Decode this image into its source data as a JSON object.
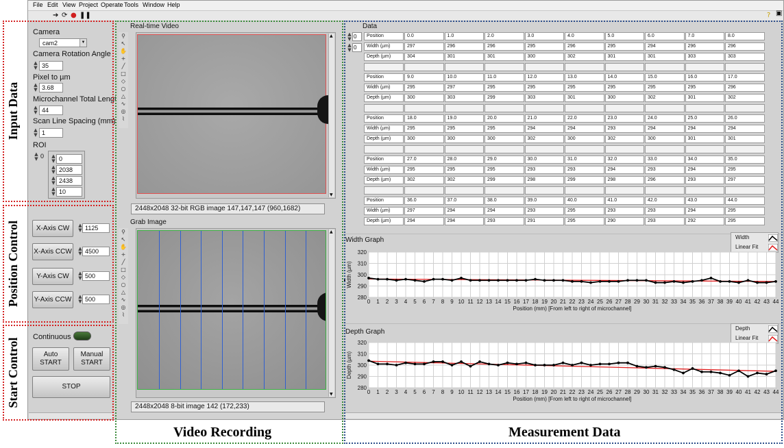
{
  "menu": [
    "File",
    "Edit",
    "View",
    "Project",
    "Operate",
    "Tools",
    "Window",
    "Help"
  ],
  "toolbar_icons": [
    "run-arrow-icon",
    "run-continuous-icon",
    "abort-icon",
    "pause-icon"
  ],
  "input_data": {
    "section_label": "Input Data",
    "camera_label": "Camera",
    "camera_value": "cam2",
    "rotation_label": "Camera Rotation Angle",
    "rotation_value": "35",
    "pixel_label": "Pixel to µm",
    "pixel_value": "3.68",
    "length_label": "Microchannel Total Length",
    "length_value": "44",
    "spacing_label": "Scan Line Spacing (mm)",
    "spacing_value": "1",
    "roi_label": "ROI",
    "roi_index": "0",
    "roi_values": [
      "0",
      "2038",
      "2438",
      "10"
    ]
  },
  "position_control": {
    "section_label": "Position Control",
    "buttons": [
      {
        "label": "X-Axis CW",
        "value": "1125"
      },
      {
        "label": "X-Axis CCW",
        "value": "4500"
      },
      {
        "label": "Y-Axis CW",
        "value": "500"
      },
      {
        "label": "Y-Axis CCW",
        "value": "500"
      }
    ]
  },
  "start_control": {
    "section_label": "Start Control",
    "continuous_label": "Continuous",
    "auto_label": "Auto START",
    "manual_label": "Manual START",
    "stop_label": "STOP"
  },
  "video": {
    "section_label": "Video Recording",
    "realtime_title": "Real-time Video",
    "realtime_status": "2448x2048 32-bit RGB image 147,147,147    (960,1682)",
    "grab_title": "Grab Image",
    "grab_status": "2448x2048 8-bit image 142    (172,233)",
    "colors": {
      "realtime_border": "#e05050",
      "grab_border": "#3cb043",
      "scan_lines": "#2f5fd0"
    }
  },
  "measurement": {
    "section_label": "Measurement Data",
    "data_title": "Data",
    "index_a": "0",
    "index_b": "0",
    "row_labels": [
      "Position",
      "Width (µm)",
      "Depth (µm)"
    ],
    "blocks": [
      {
        "position": [
          "0.0",
          "1.0",
          "2.0",
          "3.0",
          "4.0",
          "5.0",
          "6.0",
          "7.0",
          "8.0"
        ],
        "width": [
          "297",
          "296",
          "296",
          "295",
          "296",
          "295",
          "294",
          "296",
          "296"
        ],
        "depth": [
          "304",
          "301",
          "301",
          "300",
          "302",
          "301",
          "301",
          "303",
          "303"
        ]
      },
      {
        "position": [
          "9.0",
          "10.0",
          "11.0",
          "12.0",
          "13.0",
          "14.0",
          "15.0",
          "16.0",
          "17.0"
        ],
        "width": [
          "295",
          "297",
          "295",
          "295",
          "295",
          "295",
          "295",
          "295",
          "296"
        ],
        "depth": [
          "300",
          "303",
          "299",
          "303",
          "301",
          "300",
          "302",
          "301",
          "302"
        ]
      },
      {
        "position": [
          "18.0",
          "19.0",
          "20.0",
          "21.0",
          "22.0",
          "23.0",
          "24.0",
          "25.0",
          "26.0"
        ],
        "width": [
          "295",
          "295",
          "295",
          "294",
          "294",
          "293",
          "294",
          "294",
          "294"
        ],
        "depth": [
          "300",
          "300",
          "300",
          "302",
          "300",
          "302",
          "300",
          "301",
          "301"
        ]
      },
      {
        "position": [
          "27.0",
          "28.0",
          "29.0",
          "30.0",
          "31.0",
          "32.0",
          "33.0",
          "34.0",
          "35.0"
        ],
        "width": [
          "295",
          "295",
          "295",
          "293",
          "293",
          "294",
          "293",
          "294",
          "295"
        ],
        "depth": [
          "302",
          "302",
          "299",
          "298",
          "299",
          "298",
          "296",
          "293",
          "297"
        ]
      },
      {
        "position": [
          "36.0",
          "37.0",
          "38.0",
          "39.0",
          "40.0",
          "41.0",
          "42.0",
          "43.0",
          "44.0"
        ],
        "width": [
          "297",
          "294",
          "294",
          "293",
          "295",
          "293",
          "293",
          "294",
          "295"
        ],
        "depth": [
          "294",
          "294",
          "293",
          "291",
          "295",
          "290",
          "293",
          "292",
          "295"
        ]
      }
    ]
  },
  "chart_data": [
    {
      "type": "line",
      "title": "Width Graph",
      "xlabel": "Position (mm) [From left to right of microchannel]",
      "ylabel": "Width (µm)",
      "ylim": [
        280,
        320
      ],
      "yticks": [
        280,
        290,
        300,
        310,
        320
      ],
      "xlim": [
        0,
        44
      ],
      "x": [
        0,
        1,
        2,
        3,
        4,
        5,
        6,
        7,
        8,
        9,
        10,
        11,
        12,
        13,
        14,
        15,
        16,
        17,
        18,
        19,
        20,
        21,
        22,
        23,
        24,
        25,
        26,
        27,
        28,
        29,
        30,
        31,
        32,
        33,
        34,
        35,
        36,
        37,
        38,
        39,
        40,
        41,
        42,
        43,
        44
      ],
      "series": [
        {
          "name": "Width",
          "values": [
            297,
            296,
            296,
            295,
            296,
            295,
            294,
            296,
            296,
            295,
            297,
            295,
            295,
            295,
            295,
            295,
            295,
            295,
            296,
            295,
            295,
            295,
            294,
            294,
            293,
            294,
            294,
            294,
            295,
            295,
            295,
            293,
            293,
            294,
            293,
            294,
            295,
            297,
            294,
            294,
            293,
            295,
            293,
            293,
            294,
            295
          ]
        },
        {
          "name": "Linear Fit",
          "values": [
            296.2,
            294.0
          ]
        }
      ],
      "legend": "top-right",
      "grid": true,
      "colors": {
        "data": "#000000",
        "fit": "#e02020"
      }
    },
    {
      "type": "line",
      "title": "Depth Graph",
      "xlabel": "Position (mm) [From left to right of microchannel]",
      "ylabel": "Depth (µm)",
      "ylim": [
        280,
        320
      ],
      "yticks": [
        280,
        290,
        300,
        310,
        320
      ],
      "xlim": [
        0,
        44
      ],
      "x": [
        0,
        1,
        2,
        3,
        4,
        5,
        6,
        7,
        8,
        9,
        10,
        11,
        12,
        13,
        14,
        15,
        16,
        17,
        18,
        19,
        20,
        21,
        22,
        23,
        24,
        25,
        26,
        27,
        28,
        29,
        30,
        31,
        32,
        33,
        34,
        35,
        36,
        37,
        38,
        39,
        40,
        41,
        42,
        43,
        44
      ],
      "series": [
        {
          "name": "Depth",
          "values": [
            304,
            301,
            301,
            300,
            302,
            301,
            301,
            303,
            303,
            300,
            303,
            299,
            303,
            301,
            300,
            302,
            301,
            302,
            300,
            300,
            300,
            302,
            300,
            302,
            300,
            301,
            301,
            302,
            302,
            299,
            298,
            299,
            298,
            296,
            293,
            297,
            294,
            294,
            293,
            291,
            295,
            290,
            293,
            292,
            295
          ]
        },
        {
          "name": "Linear Fit",
          "values": [
            303.5,
            294.5
          ]
        }
      ],
      "legend": "top-right",
      "grid": true,
      "colors": {
        "data": "#000000",
        "fit": "#e02020"
      }
    }
  ]
}
